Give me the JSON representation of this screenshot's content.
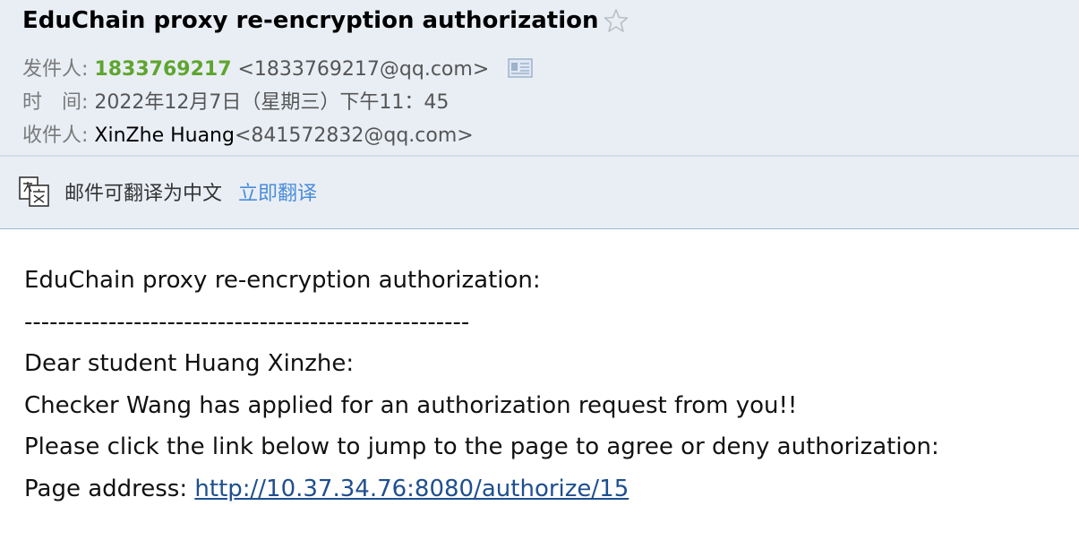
{
  "email": {
    "subject": "EduChain proxy re-encryption authorization",
    "sender_label": "发件人:",
    "sender_name": "1833769217",
    "sender_email": "<1833769217@qq.com>",
    "time_label": "时　间:",
    "time_value": "2022年12月7日（星期三）下午11：45",
    "recipient_label": "收件人:",
    "recipient_name": "XinZhe Huang",
    "recipient_email": "<841572832@qq.com>"
  },
  "translate": {
    "message": "邮件可翻译为中文",
    "action": "立即翻译"
  },
  "body": {
    "line1": "EduChain proxy re-encryption authorization:",
    "line2": "-----------------------------------------------------",
    "line3": "Dear student Huang Xinzhe:",
    "line4": "Checker Wang has applied for an authorization request from you!!",
    "line5": "Please click the link below to jump to the page to agree or deny authorization:",
    "address_label": "Page address:",
    "address_link": "http://10.37.34.76:8080/authorize/15"
  },
  "colors": {
    "header_bg": "#e9eef5",
    "sender_green": "#5ea52f",
    "link_blue": "#4a8dd8",
    "url_blue": "#1f4f8f"
  },
  "icons": {
    "star": "star-outline-icon",
    "card": "contact-card-icon",
    "translate": "translate-icon"
  }
}
